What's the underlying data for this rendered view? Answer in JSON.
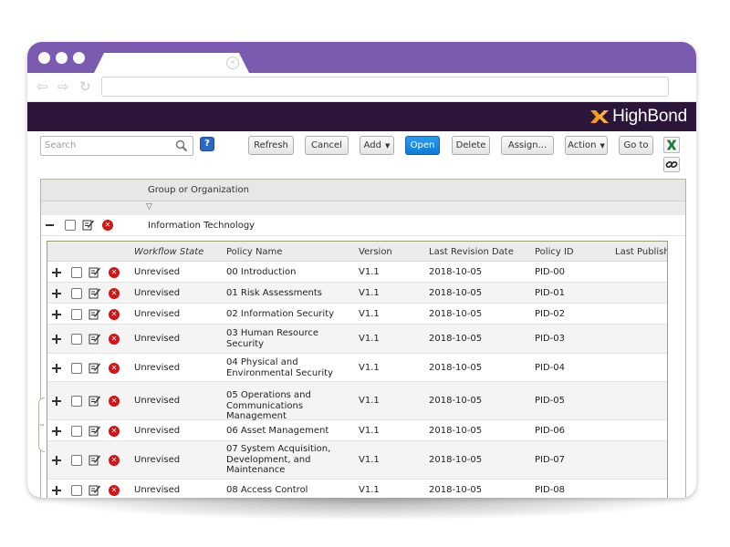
{
  "app": {
    "brand": "HighBond",
    "brand_accent": "#f39c12"
  },
  "toolbar": {
    "search_placeholder": "Search",
    "buttons": {
      "refresh": "Refresh",
      "cancel": "Cancel",
      "add": "Add",
      "open": "Open",
      "delete": "Delete",
      "assign": "Assign...",
      "action": "Action",
      "goto": "Go to"
    }
  },
  "outer_table": {
    "header": "Group or Organization",
    "group": "Information Technology"
  },
  "policy_table": {
    "columns": [
      "Workflow State",
      "Policy Name",
      "Version",
      "Last Revision Date",
      "Policy ID",
      "Last Publishe"
    ],
    "rows": [
      {
        "state": "Unrevised",
        "name": "00 Introduction",
        "version": "V1.1",
        "date": "2018-10-05",
        "pid": "PID-00"
      },
      {
        "state": "Unrevised",
        "name": "01 Risk Assessments",
        "version": "V1.1",
        "date": "2018-10-05",
        "pid": "PID-01"
      },
      {
        "state": "Unrevised",
        "name": "02 Information Security",
        "version": "V1.1",
        "date": "2018-10-05",
        "pid": "PID-02"
      },
      {
        "state": "Unrevised",
        "name": "03 Human Resource Security",
        "version": "V1.1",
        "date": "2018-10-05",
        "pid": "PID-03"
      },
      {
        "state": "Unrevised",
        "name": "04 Physical and Environmental Security",
        "version": "V1.1",
        "date": "2018-10-05",
        "pid": "PID-04"
      },
      {
        "state": "Unrevised",
        "name": "05 Operations and Communications Management",
        "version": "V1.1",
        "date": "2018-10-05",
        "pid": "PID-05"
      },
      {
        "state": "Unrevised",
        "name": "06 Asset Management",
        "version": "V1.1",
        "date": "2018-10-05",
        "pid": "PID-06"
      },
      {
        "state": "Unrevised",
        "name": "07 System Acquisition, Development, and Maintenance",
        "version": "V1.1",
        "date": "2018-10-05",
        "pid": "PID-07"
      },
      {
        "state": "Unrevised",
        "name": "08 Access Control",
        "version": "V1.1",
        "date": "2018-10-05",
        "pid": "PID-08"
      }
    ]
  }
}
